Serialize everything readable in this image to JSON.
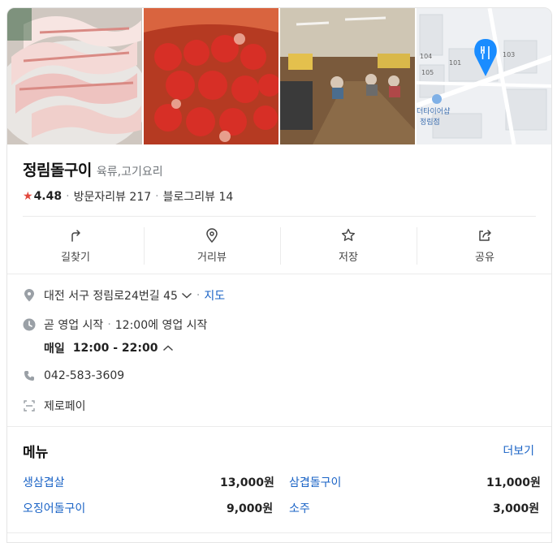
{
  "place": {
    "name": "정림돌구이",
    "category": "육류,고기요리",
    "rating": "4.48",
    "visitor_reviews": "방문자리뷰 217",
    "blog_reviews": "블로그리뷰 14"
  },
  "photos": {
    "map_labels": [
      "104",
      "101",
      "103",
      "105",
      "더타이어샵",
      "정림점"
    ]
  },
  "actions": [
    {
      "label": "길찾기",
      "icon": "directions-icon"
    },
    {
      "label": "거리뷰",
      "icon": "location-pin-icon"
    },
    {
      "label": "저장",
      "icon": "star-outline-icon"
    },
    {
      "label": "공유",
      "icon": "share-icon"
    }
  ],
  "info": {
    "address": "대전 서구 정림로24번길 45",
    "map_link": "지도",
    "status": "곧 영업 시작",
    "status_detail": "12:00에 영업 시작",
    "hours_day": "매일",
    "hours_time": "12:00 - 22:00",
    "phone": "042-583-3609",
    "payment": "제로페이"
  },
  "menu": {
    "title": "메뉴",
    "more": "더보기",
    "items": [
      {
        "name": "생삼겹살",
        "price": "13,000원"
      },
      {
        "name": "삼겹돌구이",
        "price": "11,000원"
      },
      {
        "name": "오징어돌구이",
        "price": "9,000원"
      },
      {
        "name": "소주",
        "price": "3,000원"
      }
    ]
  },
  "colors": {
    "accent": "#1a63c6",
    "star": "#e2483d",
    "map_pin": "#1a8cff"
  }
}
